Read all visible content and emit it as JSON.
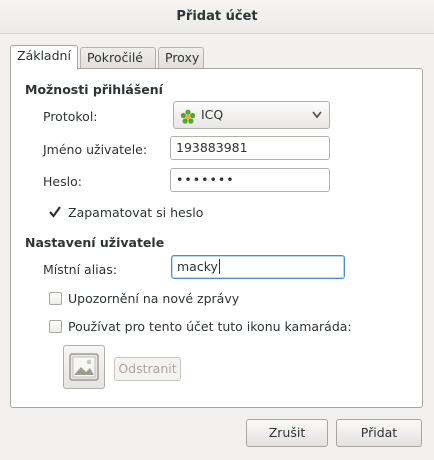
{
  "window": {
    "title": "Přidat účet"
  },
  "tabs": [
    {
      "label": "Základní",
      "active": true
    },
    {
      "label": "Pokročilé",
      "active": false
    },
    {
      "label": "Proxy",
      "active": false
    }
  ],
  "login_options": {
    "heading": "Možnosti přihlášení",
    "protocol_label": "Protokol:",
    "protocol_value": "ICQ",
    "protocol_icon": "icq-flower-icon",
    "username_label": "Jméno uživatele:",
    "username_value": "193883981",
    "password_label": "Heslo:",
    "password_value": "•••••••",
    "remember_label": "Zapamatovat si heslo",
    "remember_checked": true
  },
  "user_settings": {
    "heading": "Nastavení uživatele",
    "alias_label": "Místní alias:",
    "alias_value": "macky",
    "notify_label": "Upozornění na nové zprávy",
    "notify_checked": false,
    "buddy_icon_label": "Používat pro tento účet tuto ikonu kamaráda:",
    "buddy_icon_checked": false,
    "remove_label": "Odstranit"
  },
  "footer": {
    "cancel_label": "Zrušit",
    "add_label": "Přidat"
  },
  "colors": {
    "focus": "#4a90d9",
    "icq_green": "#54a62f",
    "icq_center": "#f2b01e"
  }
}
